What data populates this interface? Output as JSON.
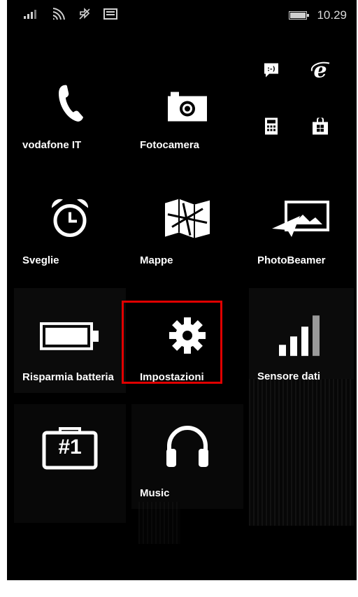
{
  "status_bar": {
    "time": "10.29",
    "icons": [
      "signal-icon",
      "wifi-icon",
      "data-sync-icon",
      "message-icon",
      "battery-icon"
    ]
  },
  "tiles": {
    "phone": {
      "label": "vodafone IT",
      "icon": "phone-icon"
    },
    "camera": {
      "label": "Fotocamera",
      "icon": "camera-icon"
    },
    "messaging": {
      "icon": "messaging-icon"
    },
    "internet_explorer": {
      "icon": "internet-explorer-icon"
    },
    "calculator": {
      "icon": "calculator-icon"
    },
    "store": {
      "icon": "store-icon"
    },
    "alarms": {
      "label": "Sveglie",
      "icon": "alarm-clock-icon"
    },
    "maps": {
      "label": "Mappe",
      "icon": "map-icon"
    },
    "photobeamer": {
      "label": "PhotoBeamer",
      "icon": "photobeamer-icon"
    },
    "battery_saver": {
      "label": "Risparmia batteria",
      "icon": "battery-saver-icon"
    },
    "settings": {
      "label": "Impostazioni",
      "icon": "gear-icon"
    },
    "data_sense": {
      "label": "Sensore dati",
      "icon": "data-sense-icon"
    },
    "app_number_one": {
      "icon": "briefcase-number-one-icon",
      "badge_text": "#1"
    },
    "music": {
      "label": "Music",
      "icon": "headphones-icon"
    }
  },
  "highlight": {
    "target": "settings",
    "color": "#e00000"
  }
}
